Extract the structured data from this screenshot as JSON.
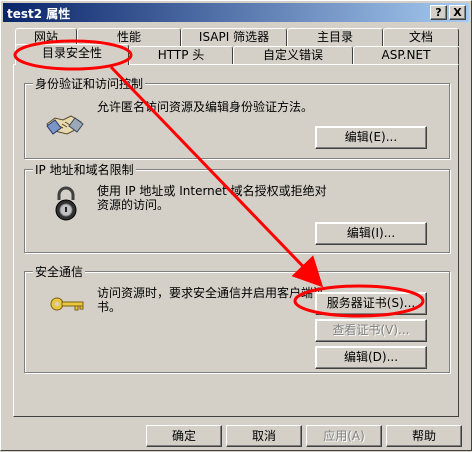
{
  "window": {
    "title": "test2 属性",
    "help_glyph": "?",
    "close_glyph": "X"
  },
  "tabs_row1": [
    {
      "label": "网站"
    },
    {
      "label": "性能"
    },
    {
      "label": "ISAPI 筛选器"
    },
    {
      "label": "主目录"
    },
    {
      "label": "文档"
    }
  ],
  "tabs_row2": [
    {
      "label": "目录安全性",
      "active": true
    },
    {
      "label": "HTTP 头"
    },
    {
      "label": "自定义错误"
    },
    {
      "label": "ASP.NET"
    }
  ],
  "groups": {
    "auth": {
      "title": "身份验证和访问控制",
      "description": "允许匿名访问资源及编辑身份验证方法。",
      "icon": "handshake-icon",
      "edit_button": "编辑(E)..."
    },
    "ip": {
      "title": "IP 地址和域名限制",
      "description": "使用 IP 地址或 Internet 域名授权或拒绝对资源的访问。",
      "icon": "padlock-icon",
      "edit_button": "编辑(I)..."
    },
    "secure": {
      "title": "安全通信",
      "description": "访问资源时，要求安全通信并启用客户端证书。",
      "icon": "key-icon",
      "server_cert_button": "服务器证书(S)...",
      "view_cert_button": "查看证书(V)...",
      "edit_button": "编辑(D)..."
    }
  },
  "footer": {
    "ok": "确定",
    "cancel": "取消",
    "apply": "应用(A)",
    "help": "帮助"
  },
  "annotation_color": "#ff0000"
}
